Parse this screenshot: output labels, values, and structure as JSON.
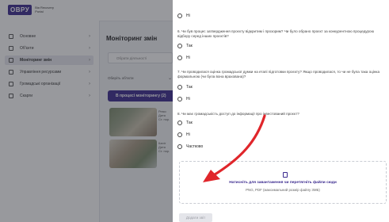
{
  "header": {
    "logo_mark": "ОВРУ",
    "logo_text": "Вія Recovery Portal"
  },
  "sidebar": {
    "items": [
      {
        "label": "Основне",
        "icon": "grid-icon"
      },
      {
        "label": "Об'єкти",
        "icon": "home-icon"
      },
      {
        "label": "Моніторинг змін",
        "icon": "home-icon"
      },
      {
        "label": "Управління ресурсами",
        "icon": "list-icon"
      },
      {
        "label": "Громадські організації",
        "icon": "building-icon"
      },
      {
        "label": "Скарги",
        "icon": "chat-icon"
      }
    ]
  },
  "main": {
    "title": "Моніторинг змін",
    "search_placeholder": "Обрати діяльності",
    "filter_label": "Оберіть об'єкти",
    "status_button": "В процесі моніторингу (2)",
    "cards": [
      {
        "line1": "Ремо",
        "line2": "Дитя",
        "line3": "Ст. нор."
      },
      {
        "line1": "Капіт",
        "line2": "Дитя",
        "line3": "Ст. нор."
      }
    ]
  },
  "modal": {
    "q_prev_answer": "Ні",
    "q6": {
      "text": "6. Чи був процес затвердження проєкту відкритим і прозорим? Чи було обрано проєкт за конкурентною процедурою відбору серед інших проєктів?",
      "options": [
        "Так",
        "Ні"
      ]
    },
    "q7": {
      "text": "7. Чи проводилася оцінка громадської думки на етапі підготовки проєкту? Якщо проводилася, то чи не була така оцінка формальною (чи була вона врахована)?",
      "options": [
        "Так",
        "Ні"
      ]
    },
    "q8": {
      "text": "8. Чи має громадськість доступ до інформації про інвестований проєкт?",
      "options": [
        "Так",
        "Ні",
        "Частково"
      ]
    },
    "upload": {
      "title": "Натисніть для завантаження чи перетягніть файли сюди",
      "hint": "PNG, PDF (максимальний розмір файлу 3МБ)"
    },
    "submit_label": "Додати звіт"
  }
}
